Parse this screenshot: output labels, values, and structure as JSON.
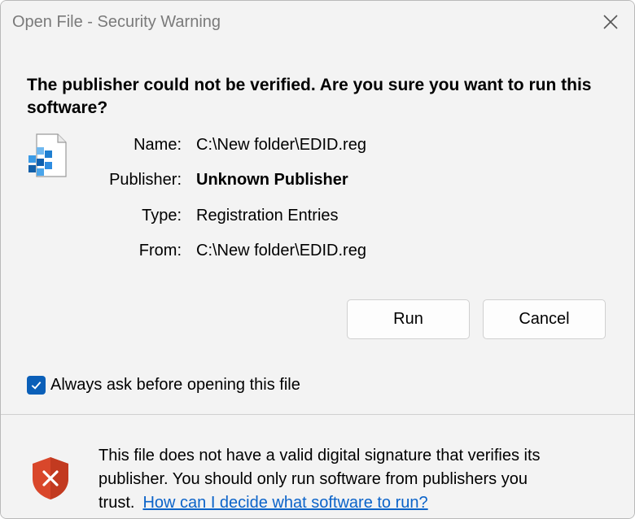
{
  "window": {
    "title": "Open File - Security Warning",
    "close_icon": "close-icon"
  },
  "main": {
    "headline": "The publisher could not be verified.  Are you sure you want to run this software?",
    "file_icon": "registry-file-icon",
    "details": {
      "name_label": "Name:",
      "name_value": "C:\\New folder\\EDID.reg",
      "publisher_label": "Publisher:",
      "publisher_value": "Unknown Publisher",
      "type_label": "Type:",
      "type_value": "Registration Entries",
      "from_label": "From:",
      "from_value": "C:\\New folder\\EDID.reg"
    },
    "buttons": {
      "run_label": "Run",
      "cancel_label": "Cancel"
    },
    "always_ask": {
      "label": "Always ask before opening this file",
      "checked": true
    }
  },
  "footer": {
    "shield_icon": "shield-warning-icon",
    "message": "This file does not have a valid digital signature that verifies its publisher.  You should only run software from publishers you trust.",
    "link_text": "How can I decide what software to run?"
  },
  "colors": {
    "accent": "#0a5fb8",
    "link": "#0b63c9",
    "shield": "#d9472b",
    "background": "#f3f3f3"
  }
}
